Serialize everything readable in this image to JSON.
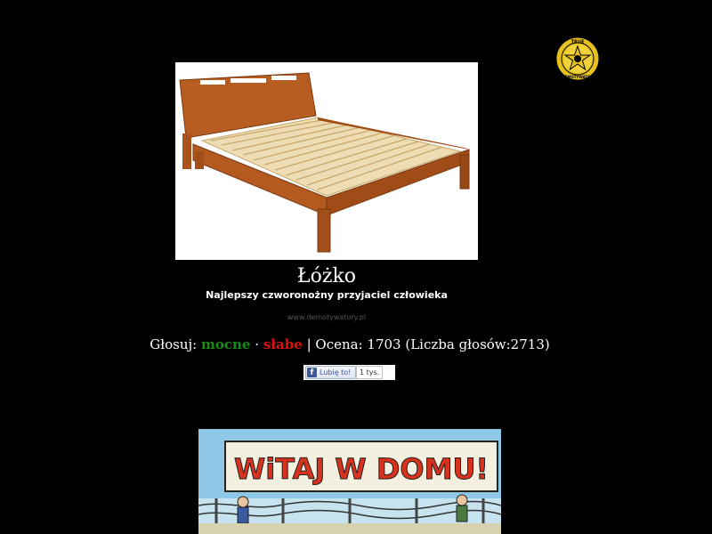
{
  "badge": {
    "top_text": "TRUE",
    "bottom_text": "DEMOTYWATOR"
  },
  "post": {
    "title": "Łóżko",
    "subtitle": "Najlepszy czworonożny przyjaciel człowieka",
    "watermark": "www.demotywatory.pl"
  },
  "vote": {
    "prefix": "Głosuj:",
    "strong_label": "mocne",
    "separator": "·",
    "weak_label": "słabe",
    "rating_text": "| Ocena: 1703 (Liczba głosów:2713)"
  },
  "facebook": {
    "button_label": "Lubię to!",
    "count": "1 tys.",
    "icon_letter": "f"
  },
  "comic": {
    "banner_text": "WiTAJ W DOMU!"
  },
  "colors": {
    "background": "#000000",
    "strong": "#1a8a1a",
    "weak": "#e01010",
    "facebook": "#3b5998"
  }
}
